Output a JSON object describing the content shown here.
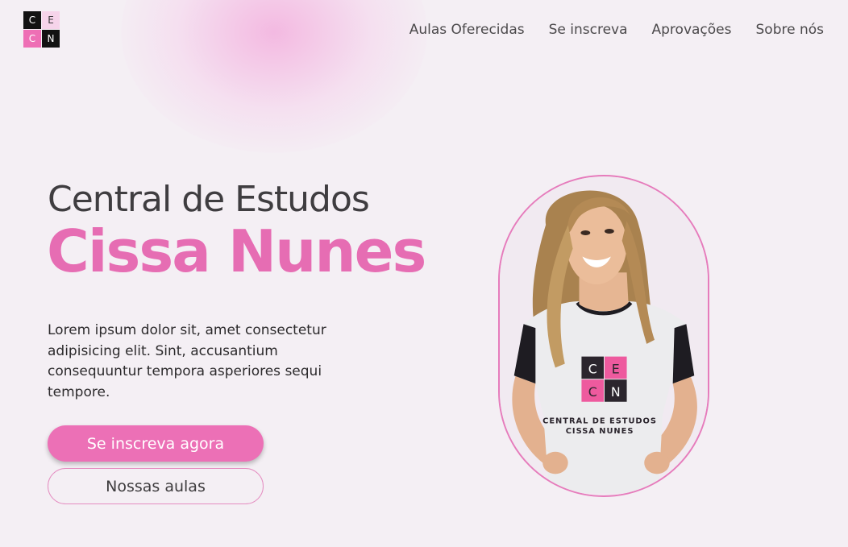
{
  "logo": {
    "letters": [
      "C",
      "E",
      "C",
      "N"
    ]
  },
  "nav": {
    "items": [
      "Aulas Oferecidas",
      "Se inscreva",
      "Aprovações",
      "Sobre nós"
    ]
  },
  "hero": {
    "title": "Central de Estudos",
    "name": "Cissa Nunes",
    "description": "Lorem ipsum dolor sit, amet consectetur adipisicing elit. Sint, accusantium consequuntur tempora asperiores sequi tempore.",
    "primary_button": "Se inscreva agora",
    "secondary_button": "Nossas aulas"
  },
  "shirt": {
    "logo_letters": [
      "C",
      "E",
      "C",
      "N"
    ],
    "line1": "CENTRAL DE ESTUDOS",
    "line2": "CISSA NUNES"
  },
  "colors": {
    "accent": "#e66db3",
    "background": "#f4eff4"
  }
}
